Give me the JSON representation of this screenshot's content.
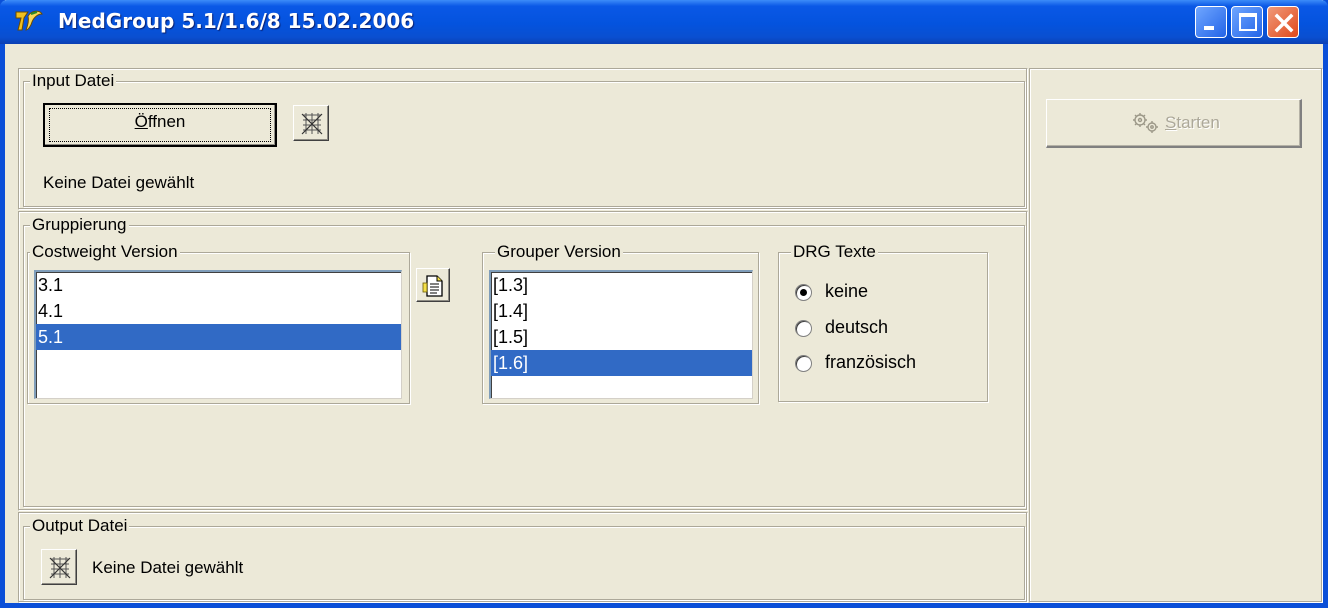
{
  "window": {
    "title": "MedGroup 5.1/1.6/8 15.02.2006"
  },
  "input": {
    "legend": "Input Datei",
    "open_button_label": "Öffnen",
    "open_button_mnemonic": "Ö",
    "open_button_rest": "ffnen",
    "status": "Keine Datei gewählt"
  },
  "grouping": {
    "legend": "Gruppierung",
    "costweight": {
      "legend": "Costweight Version",
      "items": [
        "3.1",
        "4.1",
        "5.1"
      ],
      "selected": "5.1"
    },
    "grouper": {
      "legend": "Grouper Version",
      "items": [
        "[1.3]",
        "[1.4]",
        "[1.5]",
        "[1.6]"
      ],
      "selected": "[1.6]"
    },
    "drg_texts": {
      "legend": "DRG Texte",
      "options": [
        "keine",
        "deutsch",
        "französisch"
      ],
      "selected": "keine"
    }
  },
  "output": {
    "legend": "Output Datei",
    "status": "Keine Datei gewählt"
  },
  "actions": {
    "start_label": "Starten",
    "start_mnemonic": "S",
    "start_rest": "tarten",
    "start_enabled": false
  },
  "colors": {
    "titlebar": "#0453de",
    "selection": "#316ac5",
    "face": "#ece9d8"
  }
}
